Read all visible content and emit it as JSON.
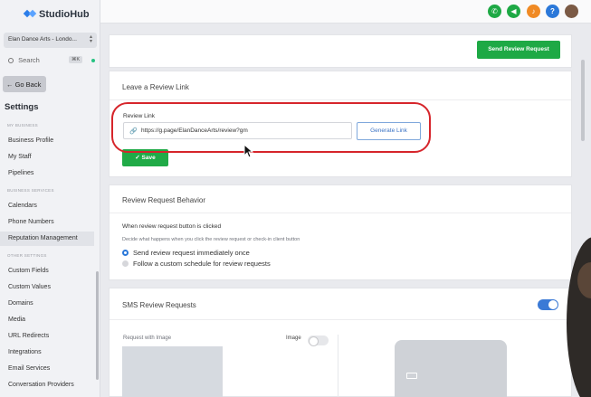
{
  "brand": {
    "name": "StudioHub",
    "accent": "#2b7de9"
  },
  "sidebar": {
    "location": "Elan Dance Arts - Londo...",
    "search_label": "Search",
    "search_shortcut": "⌘K",
    "go_back": "Go Back",
    "settings_title": "Settings",
    "sections": [
      {
        "label": "MY BUSINESS"
      },
      {
        "label": "BUSINESS SERVICES"
      },
      {
        "label": "OTHER SETTINGS"
      }
    ],
    "items": [
      {
        "label": "Business Profile"
      },
      {
        "label": "My Staff"
      },
      {
        "label": "Pipelines"
      },
      {
        "label": "Calendars"
      },
      {
        "label": "Phone Numbers"
      },
      {
        "label": "Reputation Management"
      },
      {
        "label": "Custom Fields"
      },
      {
        "label": "Custom Values"
      },
      {
        "label": "Domains"
      },
      {
        "label": "Media"
      },
      {
        "label": "URL Redirects"
      },
      {
        "label": "Integrations"
      },
      {
        "label": "Email Services"
      },
      {
        "label": "Conversation Providers"
      }
    ],
    "active_item": "Reputation Management"
  },
  "topbar": {
    "icons": [
      "phone-icon",
      "megaphone-icon",
      "bell-icon",
      "help-icon",
      "avatar"
    ],
    "colors": [
      "#1ea945",
      "#1ea945",
      "#f08a24",
      "#2b78d9"
    ],
    "help_glyph": "?"
  },
  "main": {
    "send_review_button": "Send Review Request",
    "review_link_card": {
      "title": "Leave a Review Link",
      "field_label": "Review Link",
      "url_value": "https://g.page/ElanDanceArts/review?gm",
      "generate_button": "Generate Link",
      "save_button": "Save"
    },
    "behavior_card": {
      "title": "Review Request Behavior",
      "question": "When review request button is clicked",
      "helper": "Decide what happens when you click the review request or check-in client button",
      "options": [
        {
          "label": "Send review request immediately once",
          "selected": true
        },
        {
          "label": "Follow a custom schedule for review requests",
          "selected": false
        }
      ]
    },
    "sms_card": {
      "title": "SMS Review Requests",
      "enabled": true,
      "request_with_image_label": "Request with Image",
      "image_label": "Image",
      "image_toggle": false
    }
  }
}
